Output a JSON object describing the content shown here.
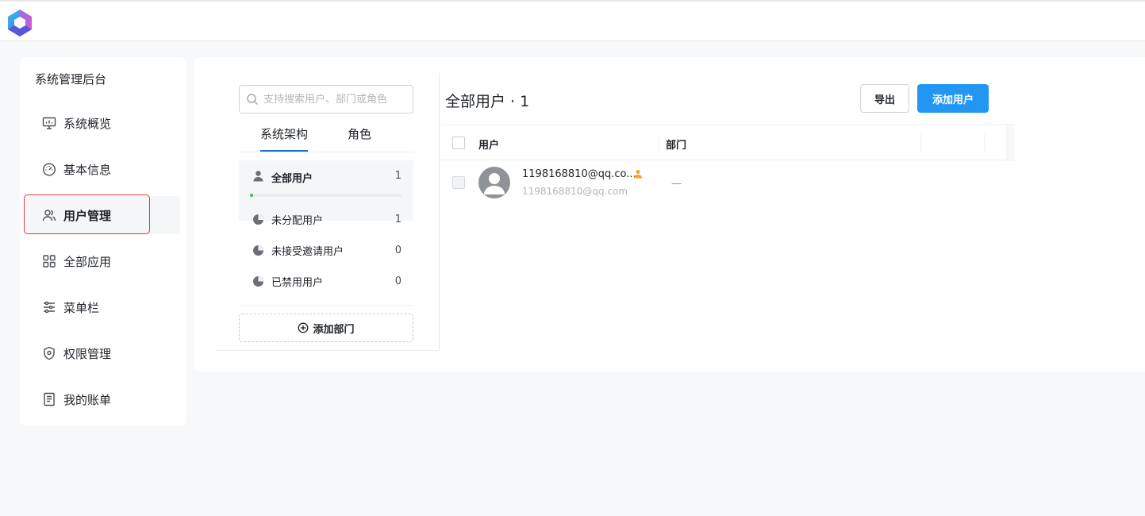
{
  "sidebar": {
    "title": "系统管理后台",
    "items": [
      {
        "label": "系统概览",
        "icon": "monitor-chart-icon"
      },
      {
        "label": "基本信息",
        "icon": "dashboard-gauge-icon"
      },
      {
        "label": "用户管理",
        "icon": "users-icon"
      },
      {
        "label": "全部应用",
        "icon": "apps-grid-icon"
      },
      {
        "label": "菜单栏",
        "icon": "sliders-icon"
      },
      {
        "label": "权限管理",
        "icon": "shield-icon"
      },
      {
        "label": "我的账单",
        "icon": "bill-document-icon"
      }
    ],
    "active_index": 2
  },
  "org_panel": {
    "search_placeholder": "支持搜索用户、部门或角色",
    "tabs": [
      "系统架构",
      "角色"
    ],
    "active_tab": 0,
    "groups": [
      {
        "label": "全部用户",
        "count": "1"
      },
      {
        "label": "未分配用户",
        "count": "1"
      },
      {
        "label": "未接受邀请用户",
        "count": "0"
      },
      {
        "label": "已禁用用户",
        "count": "0"
      }
    ],
    "all_users_progress": 0.02,
    "add_department_label": "添加部门"
  },
  "content": {
    "title": "全部用户 · 1",
    "export_label": "导出",
    "add_user_label": "添加用户",
    "columns": [
      "用户",
      "部门"
    ],
    "rows": [
      {
        "name": "1198168810@qq.co...",
        "email": "1198168810@qq.com",
        "department": "—"
      }
    ]
  },
  "colors": {
    "primary": "#2196f3",
    "tab_underline": "#1f6fd3",
    "progress": "#2ec26a",
    "admin_badge": "#f5a623",
    "highlight_border": "#e0363b"
  }
}
